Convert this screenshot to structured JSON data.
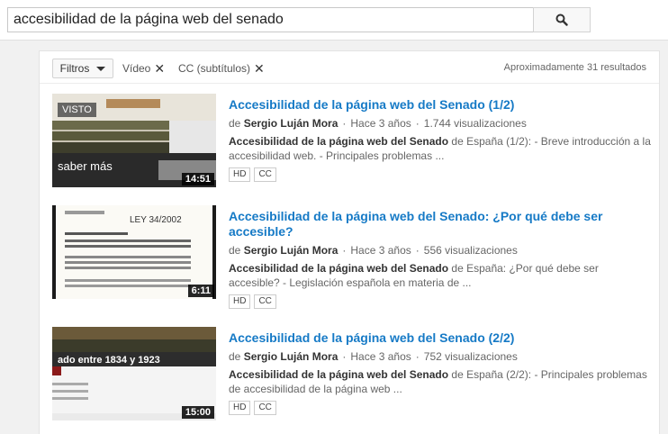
{
  "search": {
    "query": "accesibilidad de la página web del senado"
  },
  "filters": {
    "button_label": "Filtros",
    "chips": [
      "Vídeo",
      "CC (subtítulos)"
    ],
    "result_count": "Aproximadamente 31 resultados"
  },
  "results": [
    {
      "title": "Accesibilidad de la página web del Senado (1/2)",
      "by": "de",
      "channel": "Sergio Luján Mora",
      "age": "Hace 3 años",
      "views": "1.744 visualizaciones",
      "desc_bold": "Accesibilidad de la página web del Senado",
      "desc_rest": " de España (1/2): - Breve introducción a la accesibilidad web. - Principales problemas ...",
      "badges": [
        "HD",
        "CC"
      ],
      "duration": "14:51",
      "watched_label": "VISTO",
      "thumb_text": "saber más"
    },
    {
      "title": "Accesibilidad de la página web del Senado: ¿Por qué debe ser accesible?",
      "by": "de",
      "channel": "Sergio Luján Mora",
      "age": "Hace 3 años",
      "views": "556 visualizaciones",
      "desc_bold": "Accesibilidad de la página web del Senado",
      "desc_rest": " de España: ¿Por qué debe ser accesible? - Legislación española en materia de ...",
      "badges": [
        "HD",
        "CC"
      ],
      "duration": "6:11",
      "thumb_text": "LEY 34/2002"
    },
    {
      "title": "Accesibilidad de la página web del Senado (2/2)",
      "by": "de",
      "channel": "Sergio Luján Mora",
      "age": "Hace 3 años",
      "views": "752 visualizaciones",
      "desc_bold": "Accesibilidad de la página web del Senado",
      "desc_rest": " de España (2/2): - Principales problemas de accesibilidad de la página web ...",
      "badges": [
        "HD",
        "CC"
      ],
      "duration": "15:00",
      "thumb_text": "ado entre 1834 y 1923"
    }
  ]
}
